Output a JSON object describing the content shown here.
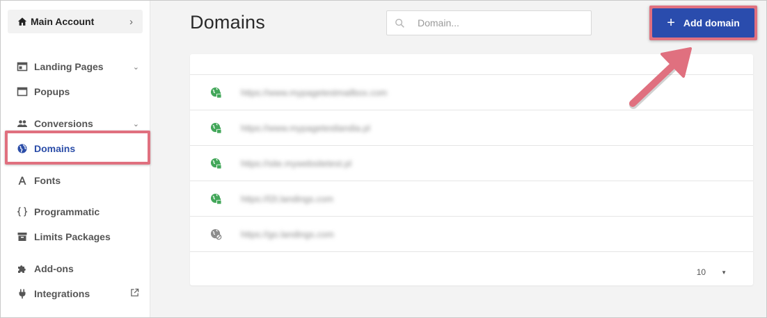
{
  "sidebar": {
    "account": {
      "label": "Main Account",
      "chevron": "›",
      "icon": "home-icon"
    },
    "items": [
      {
        "key": "landing-pages",
        "label": "Landing Pages",
        "icon": "landing-page-icon",
        "caret": "⌄"
      },
      {
        "key": "popups",
        "label": "Popups",
        "icon": "popup-window-icon"
      },
      {
        "key": "conversions",
        "label": "Conversions",
        "icon": "people-icon",
        "caret": "⌄"
      },
      {
        "key": "domains",
        "label": "Domains",
        "icon": "globe-icon",
        "active": true
      },
      {
        "key": "fonts",
        "label": "Fonts",
        "icon": "font-letter-icon"
      },
      {
        "key": "programmatic",
        "label": "Programmatic",
        "icon": "curly-braces-icon"
      },
      {
        "key": "limits-packages",
        "label": "Limits Packages",
        "icon": "archive-box-icon"
      },
      {
        "key": "add-ons",
        "label": "Add-ons",
        "icon": "puzzle-piece-icon"
      },
      {
        "key": "integrations",
        "label": "Integrations",
        "icon": "plug-icon",
        "external": "external-link-icon"
      }
    ]
  },
  "header": {
    "title": "Domains",
    "search": {
      "placeholder": "Domain...",
      "value": ""
    },
    "add_button_label": "Add domain",
    "add_button_icon": "+"
  },
  "table": {
    "rows": [
      {
        "domain": "https://www.mypagetestmailbox.com",
        "secure": true
      },
      {
        "domain": "https://www.mypagetestlandia.pl",
        "secure": true
      },
      {
        "domain": "https://site.mywebsitetest.pl",
        "secure": true
      },
      {
        "domain": "https://l2t.landings.com",
        "secure": true
      },
      {
        "domain": "https://go.landings.com",
        "secure": false
      }
    ],
    "page_size": "10",
    "page_size_caret": "▼"
  },
  "colors": {
    "accent": "#2a4cad",
    "highlight": "#e0707f",
    "secure_icon": "#43a75a",
    "insecure_icon": "#8d8d8d"
  }
}
